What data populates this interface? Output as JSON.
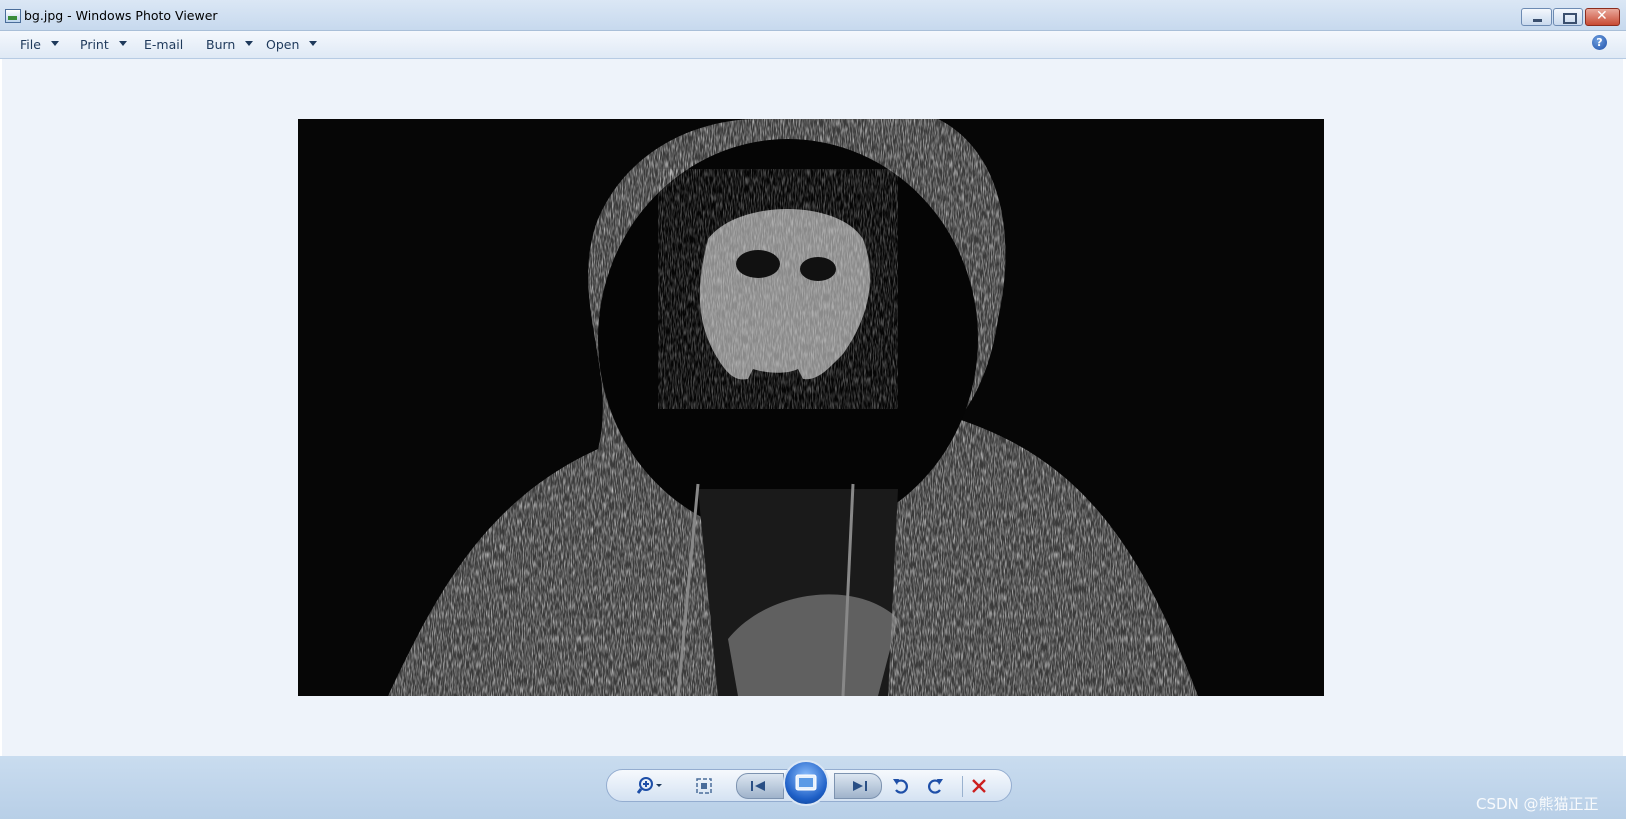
{
  "window": {
    "title": "bg.jpg - Windows Photo Viewer"
  },
  "menu": {
    "file": "File",
    "print": "Print",
    "email": "E-mail",
    "burn": "Burn",
    "open": "Open",
    "help": "?"
  },
  "icons": {
    "app": "photo-viewer-icon",
    "minimize": "minimize-icon",
    "maximize": "maximize-icon",
    "close": "close-icon",
    "help": "help-icon",
    "zoom": "zoom-icon",
    "fit": "actual-size-icon",
    "previous": "previous-icon",
    "slideshow": "slideshow-icon",
    "next": "next-icon",
    "rotate_left": "rotate-counterclockwise-icon",
    "rotate_right": "rotate-clockwise-icon",
    "delete": "delete-icon"
  },
  "colors": {
    "viewer_bg": "#eef3fa",
    "bottom_bar": "#c9dcef",
    "delete_red": "#cc1f1f",
    "accent_blue": "#1e5fc6"
  },
  "watermark": "CSDN @熊猫正正"
}
